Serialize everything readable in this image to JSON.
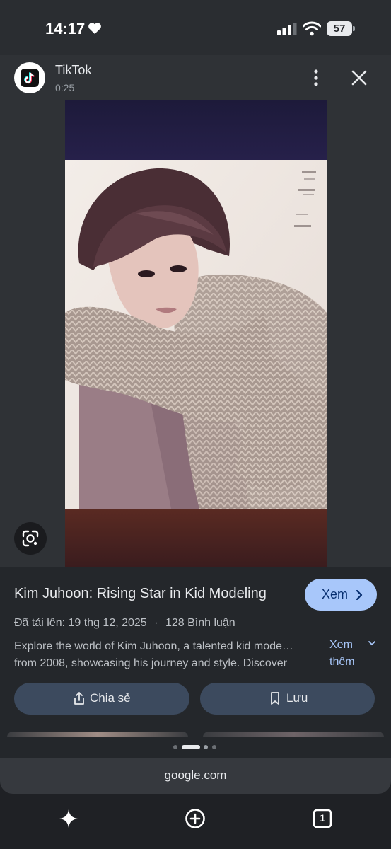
{
  "status_bar": {
    "time": "14:17",
    "battery": "57"
  },
  "source": {
    "name": "TikTok",
    "duration": "0:25"
  },
  "result": {
    "title": "Kim Juhoon: Rising Star in Kid Modeling",
    "visit_label": "Xem",
    "uploaded": "Đã tải lên: 19 thg 12, 2025",
    "separator": "·",
    "comments": "128 Bình luận",
    "description_line1": "Explore the world of Kim Juhoon, a talented kid mode…",
    "description_line2": "from 2008, showcasing his journey and style. Discover",
    "more_line1": "Xem",
    "more_line2": "thêm",
    "share_label": "Chia sẻ",
    "save_label": "Lưu"
  },
  "url": "google.com",
  "icons": {
    "heart": "heart-icon",
    "signal": "signal-icon",
    "wifi": "wifi-icon",
    "battery": "battery-icon",
    "tiktok": "tiktok-logo-icon",
    "more": "more-vert-icon",
    "close": "close-icon",
    "lens": "google-lens-icon",
    "chevron_right": "chevron-right-icon",
    "chevron_down": "chevron-down-icon",
    "share": "share-icon",
    "bookmark": "bookmark-icon",
    "gemini": "sparkle-icon",
    "new_tab": "add-circle-icon",
    "tabs": "tab-switcher-icon"
  },
  "tab_count": "1",
  "colors": {
    "accent": "#a8c7fa",
    "button": "#3c4a5e",
    "panel": "#24272b",
    "background": "#1f2125"
  }
}
